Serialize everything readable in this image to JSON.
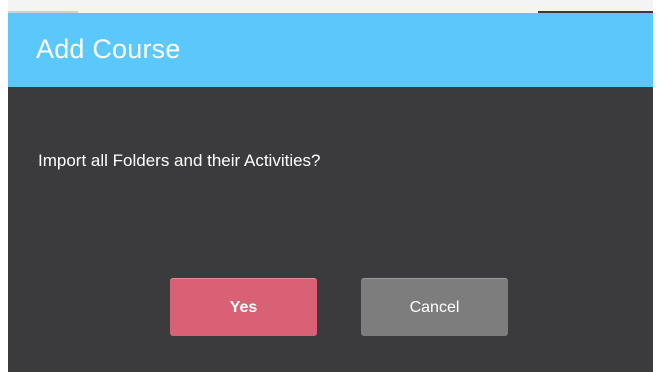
{
  "dialog": {
    "title": "Add Course",
    "message": "Import all Folders and their Activities?",
    "yes_label": "Yes",
    "cancel_label": "Cancel"
  },
  "colors": {
    "header": "#5ac8fb",
    "body": "#3b3b3d",
    "yes_button": "#d96175",
    "cancel_button": "#7d7d7d",
    "text": "#ffffff"
  }
}
